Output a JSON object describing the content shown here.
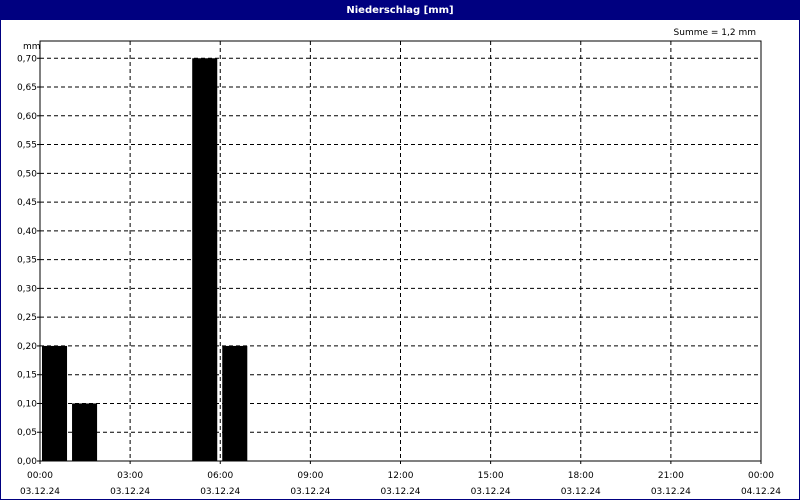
{
  "window": {
    "title": "Niederschlag [mm]"
  },
  "summary": "Summe = 1,2 mm",
  "chart_data": {
    "type": "bar",
    "title": "Niederschlag [mm]",
    "ylabel": "mm",
    "ylim": [
      0,
      0.73
    ],
    "grid": true,
    "y_ticks": [
      0,
      0.05,
      0.1,
      0.15,
      0.2,
      0.25,
      0.3,
      0.35,
      0.4,
      0.45,
      0.5,
      0.55,
      0.6,
      0.65,
      0.7
    ],
    "y_tick_labels": [
      "0,00",
      "0,05",
      "0,10",
      "0,15",
      "0,20",
      "0,25",
      "0,30",
      "0,35",
      "0,40",
      "0,45",
      "0,50",
      "0,55",
      "0,60",
      "0,65",
      "0,70"
    ],
    "x_range_hours": [
      0,
      24
    ],
    "x_ticks": [
      {
        "time": "00:00",
        "date": "03.12.24"
      },
      {
        "time": "03:00",
        "date": "03.12.24"
      },
      {
        "time": "06:00",
        "date": "03.12.24"
      },
      {
        "time": "09:00",
        "date": "03.12.24"
      },
      {
        "time": "12:00",
        "date": "03.12.24"
      },
      {
        "time": "15:00",
        "date": "03.12.24"
      },
      {
        "time": "18:00",
        "date": "03.12.24"
      },
      {
        "time": "21:00",
        "date": "03.12.24"
      },
      {
        "time": "00:00",
        "date": "04.12.24"
      }
    ],
    "bars": [
      {
        "start": "00:00",
        "end": "01:00",
        "value": 0.2
      },
      {
        "start": "01:00",
        "end": "02:00",
        "value": 0.1
      },
      {
        "start": "05:00",
        "end": "06:00",
        "value": 0.7
      },
      {
        "start": "06:00",
        "end": "07:00",
        "value": 0.2
      }
    ],
    "bar_color": "#000000"
  }
}
